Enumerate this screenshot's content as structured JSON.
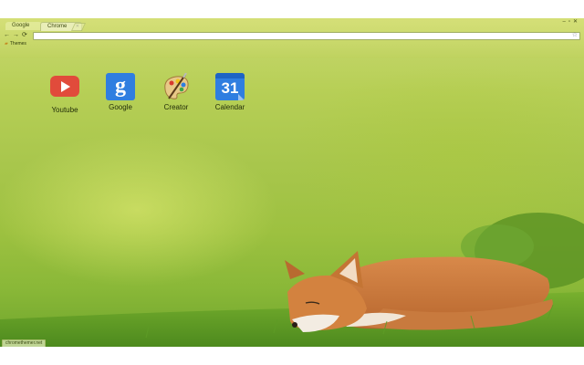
{
  "browser": {
    "tabs": [
      {
        "label": "Google",
        "active": false
      },
      {
        "label": "Chrome",
        "active": true
      }
    ],
    "nav": {
      "back": "←",
      "forward": "→",
      "reload": "⟳"
    },
    "omnibox": {
      "value": ""
    },
    "star": "☆",
    "window_controls": "‒▫✕",
    "bookmarks": [
      {
        "label": "Themes"
      }
    ],
    "status_text": "chromethemer.net"
  },
  "apps": [
    {
      "label": "Youtube",
      "icon": "youtube-icon"
    },
    {
      "label": "Google",
      "icon": "google-icon",
      "glyph": "g"
    },
    {
      "label": "Creator",
      "icon": "palette-icon"
    },
    {
      "label": "Calendar",
      "icon": "calendar-icon",
      "glyph": "31"
    }
  ],
  "colors": {
    "youtube": "#e14b3b",
    "google_blue": "#2f7ee0",
    "calendar_blue": "#2f7ee0"
  }
}
